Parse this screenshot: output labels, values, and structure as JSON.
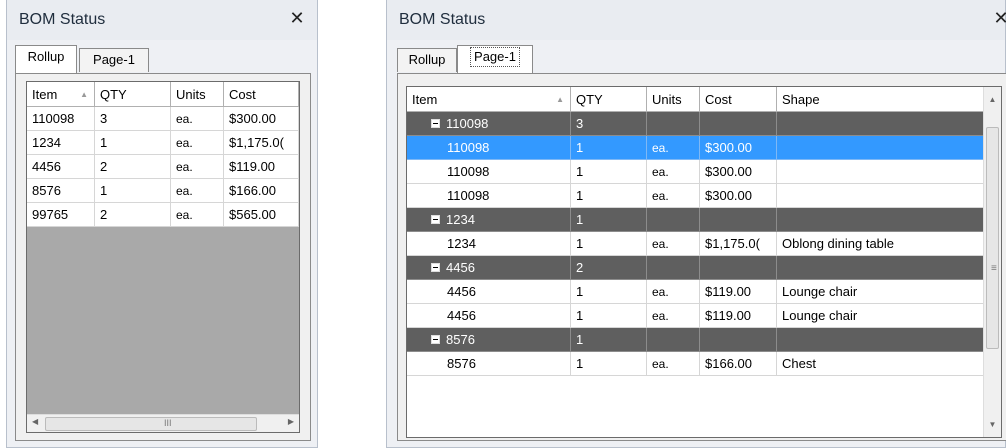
{
  "left_panel": {
    "title": "BOM Status",
    "close_glyph": "✕",
    "tabs": [
      {
        "label": "Rollup",
        "active": true
      },
      {
        "label": "Page-1",
        "active": false
      }
    ],
    "columns": [
      "Item",
      "QTY",
      "Units",
      "Cost"
    ],
    "rows": [
      [
        "110098",
        "3",
        "ea.",
        "$300.00"
      ],
      [
        "1234",
        "1",
        "ea.",
        "$1,175.0("
      ],
      [
        "4456",
        "2",
        "ea.",
        "$119.00"
      ],
      [
        "8576",
        "1",
        "ea.",
        "$166.00"
      ],
      [
        "99765",
        "2",
        "ea.",
        "$565.00"
      ]
    ],
    "hscroll_grip": "III"
  },
  "right_panel": {
    "title": "BOM Status",
    "close_glyph": "✕",
    "tabs": [
      {
        "label": "Rollup",
        "active": false
      },
      {
        "label": "Page-1",
        "active": true
      }
    ],
    "columns": [
      "Item",
      "QTY",
      "Units",
      "Cost",
      "Shape"
    ],
    "rows": [
      {
        "kind": "group",
        "item": "110098",
        "qty": "3"
      },
      {
        "kind": "detail",
        "selected": true,
        "item": "110098",
        "qty": "1",
        "units": "ea.",
        "cost": "$300.00",
        "shape": ""
      },
      {
        "kind": "detail",
        "item": "110098",
        "qty": "1",
        "units": "ea.",
        "cost": "$300.00",
        "shape": ""
      },
      {
        "kind": "detail",
        "item": "110098",
        "qty": "1",
        "units": "ea.",
        "cost": "$300.00",
        "shape": ""
      },
      {
        "kind": "group",
        "item": "1234",
        "qty": "1"
      },
      {
        "kind": "detail",
        "item": "1234",
        "qty": "1",
        "units": "ea.",
        "cost": "$1,175.0(",
        "shape": "Oblong dining table"
      },
      {
        "kind": "group",
        "item": "4456",
        "qty": "2"
      },
      {
        "kind": "detail",
        "item": "4456",
        "qty": "1",
        "units": "ea.",
        "cost": "$119.00",
        "shape": "Lounge chair"
      },
      {
        "kind": "detail",
        "item": "4456",
        "qty": "1",
        "units": "ea.",
        "cost": "$119.00",
        "shape": "Lounge chair"
      },
      {
        "kind": "group",
        "item": "8576",
        "qty": "1"
      },
      {
        "kind": "detail",
        "item": "8576",
        "qty": "1",
        "units": "ea.",
        "cost": "$166.00",
        "shape": "Chest"
      }
    ],
    "vscroll_grip": "≡"
  },
  "colors": {
    "group_row": "#5f5f5f",
    "selected_row": "#3399ff",
    "empty_grid": "#a9a9a9"
  }
}
